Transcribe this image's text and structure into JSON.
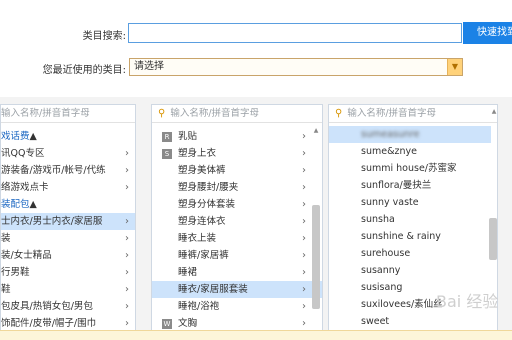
{
  "search": {
    "label": "类目搜索:",
    "button": "快速找到"
  },
  "recent": {
    "label": "您最近使用的类目:",
    "value": "请选择"
  },
  "columns": {
    "placeholder": "输入名称/拼音首字母",
    "col1": {
      "items": [
        {
          "text": "戏话费",
          "type": "group"
        },
        {
          "text": "讯QQ专区",
          "type": "item"
        },
        {
          "text": "游装备/游戏币/帐号/代练",
          "type": "item"
        },
        {
          "text": "络游戏点卡",
          "type": "item"
        },
        {
          "text": "装配包",
          "type": "group"
        },
        {
          "text": "士内衣/男士内衣/家居服",
          "type": "item",
          "selected": true
        },
        {
          "text": "装",
          "type": "item"
        },
        {
          "text": "装/女士精品",
          "type": "item"
        },
        {
          "text": "行男鞋",
          "type": "item"
        },
        {
          "text": "鞋",
          "type": "item"
        },
        {
          "text": "包皮具/热销女包/男包",
          "type": "item"
        },
        {
          "text": "饰配件/皮带/帽子/围巾",
          "type": "item"
        }
      ]
    },
    "col2": {
      "items": [
        {
          "letter": "R",
          "text": "乳贴"
        },
        {
          "letter": "S",
          "text": "塑身上衣"
        },
        {
          "letter": "",
          "text": "塑身美体裤"
        },
        {
          "letter": "",
          "text": "塑身腰封/腰夹"
        },
        {
          "letter": "",
          "text": "塑身分体套装"
        },
        {
          "letter": "",
          "text": "塑身连体衣"
        },
        {
          "letter": "",
          "text": "睡衣上装"
        },
        {
          "letter": "",
          "text": "睡裤/家居裤"
        },
        {
          "letter": "",
          "text": "睡裙"
        },
        {
          "letter": "",
          "text": "睡衣/家居服套装",
          "selected": true
        },
        {
          "letter": "",
          "text": "睡袍/浴袍"
        },
        {
          "letter": "W",
          "text": "文胸"
        }
      ]
    },
    "col3": {
      "items": [
        {
          "text": "sumeasunre",
          "selected": true,
          "blurred": true
        },
        {
          "text": "sume&znye"
        },
        {
          "text": "summi house/苏蜜家"
        },
        {
          "text": "sunflora/曼抉兰"
        },
        {
          "text": "sunny vaste"
        },
        {
          "text": "sunsha"
        },
        {
          "text": "sunshine & rainy"
        },
        {
          "text": "surehouse"
        },
        {
          "text": "susanny"
        },
        {
          "text": "susisang"
        },
        {
          "text": "suxilovees/素仙丝"
        },
        {
          "text": "sweet"
        }
      ]
    }
  },
  "watermark": "Bai 经验",
  "colors": {
    "accent": "#1b82e6",
    "selected_bg": "#cde3fb",
    "group_title": "#1a66c2"
  }
}
